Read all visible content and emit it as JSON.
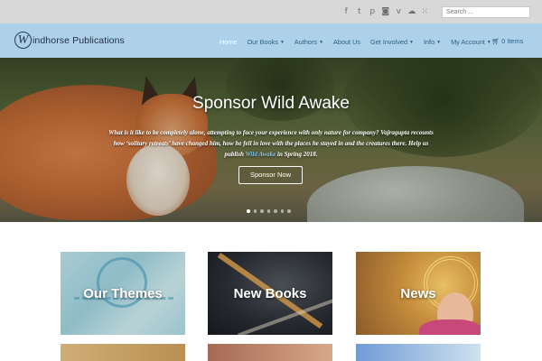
{
  "social": {
    "icons": [
      {
        "name": "facebook-icon",
        "glyph": "f"
      },
      {
        "name": "twitter-icon",
        "glyph": "t"
      },
      {
        "name": "pinterest-icon",
        "glyph": "p"
      },
      {
        "name": "instagram-icon",
        "glyph": "◙"
      },
      {
        "name": "vimeo-icon",
        "glyph": "v"
      },
      {
        "name": "soundcloud-icon",
        "glyph": "☁"
      },
      {
        "name": "flickr-icon",
        "glyph": "⁙"
      }
    ],
    "search_placeholder": "Search ..."
  },
  "brand": {
    "logo_letter": "W",
    "name": "indhorse Publications"
  },
  "nav": {
    "items": [
      {
        "label": "Home",
        "active": true,
        "dropdown": false
      },
      {
        "label": "Our Books",
        "active": false,
        "dropdown": true
      },
      {
        "label": "Authors",
        "active": false,
        "dropdown": true
      },
      {
        "label": "About Us",
        "active": false,
        "dropdown": false
      },
      {
        "label": "Get Involved",
        "active": false,
        "dropdown": true
      },
      {
        "label": "Info",
        "active": false,
        "dropdown": true
      },
      {
        "label": "My Account",
        "active": false,
        "dropdown": true
      }
    ],
    "cart_label": "0 Items",
    "caret": "▼"
  },
  "hero": {
    "title": "Sponsor Wild Awake",
    "desc_pre": "What is it like to be completely alone, attempting to face your experience with only nature for company? Vajragupta recounts how ‘solitary retreats’ have changed him, how he fell in love with the places he stayed in and the creatures there.  Help us publish ",
    "desc_link": "Wild Awake",
    "desc_post": " in Spring 2018.",
    "button_label": "Sponsor Now",
    "slides": 7,
    "active_slide": 0
  },
  "tiles": [
    {
      "label": "Our Themes"
    },
    {
      "label": "New Books"
    },
    {
      "label": "News"
    },
    {
      "label": ""
    },
    {
      "label": ""
    },
    {
      "label": ""
    }
  ],
  "colors": {
    "nav_bg": "#aed1ea",
    "topbar_bg": "#d8d8d8",
    "menu_text": "#2c5f86",
    "link_accent": "#7fc3f0"
  }
}
